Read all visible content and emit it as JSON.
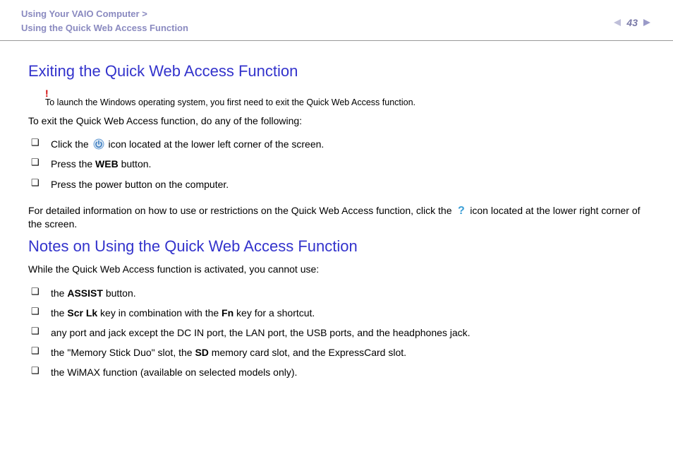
{
  "header": {
    "breadcrumb_l1": "Using Your VAIO Computer",
    "breadcrumb_sep": ">",
    "breadcrumb_l2": "Using the Quick Web Access Function",
    "page_number": "43"
  },
  "s1": {
    "heading": "Exiting the Quick Web Access Function",
    "warn_mark": "!",
    "warn_text": "To launch the Windows operating system, you first need to exit the Quick Web Access function.",
    "intro": "To exit the Quick Web Access function, do any of the following:",
    "li1_a": "Click the ",
    "li1_b": " icon located at the lower left corner of the screen.",
    "li2_a": "Press the ",
    "li2_web": "WEB",
    "li2_b": " button.",
    "li3": "Press the power button on the computer.",
    "detail_a": "For detailed information on how to use or restrictions on the Quick Web Access function, click the ",
    "detail_b": " icon located at the lower right corner of the screen."
  },
  "s2": {
    "heading": "Notes on Using the Quick Web Access Function",
    "intro": "While the Quick Web Access function is activated, you cannot use:",
    "li1_a": "the ",
    "li1_assist": "ASSIST",
    "li1_b": " button.",
    "li2_a": "the ",
    "li2_scrlk": "Scr Lk",
    "li2_b": " key in combination with the ",
    "li2_fn": "Fn",
    "li2_c": " key for a shortcut.",
    "li3": "any port and jack except the DC IN port, the LAN port, the USB ports, and the headphones jack.",
    "li4_a": "the \"Memory Stick Duo\" slot, the ",
    "li4_sd": "SD",
    "li4_b": " memory card slot, and the ExpressCard slot.",
    "li5": "the WiMAX function (available on selected models only)."
  }
}
